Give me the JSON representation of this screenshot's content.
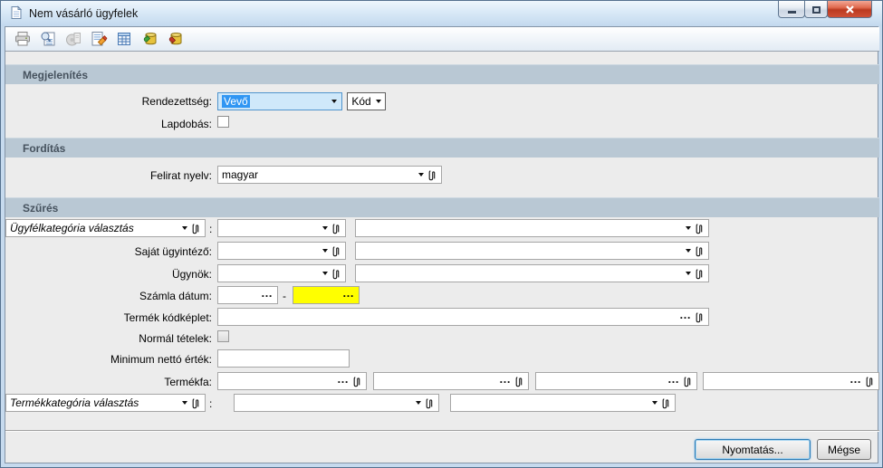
{
  "window": {
    "title": "Nem vásárló ügyfelek"
  },
  "toolbar": {
    "icons": [
      {
        "name": "print"
      },
      {
        "name": "print-preview"
      },
      {
        "name": "export-disabled"
      },
      {
        "name": "edit-report"
      },
      {
        "name": "table-settings"
      },
      {
        "name": "db-refresh"
      },
      {
        "name": "db-rollback"
      }
    ]
  },
  "megjelenites": {
    "title": "Megjelenítés",
    "rendezettseg_label": "Rendezettség:",
    "rendezettseg_value": "Vevő",
    "kod_label": "Kód",
    "lapdobas_label": "Lapdobás:"
  },
  "forditas": {
    "title": "Fordítás",
    "felirat_label": "Felirat nyelv:",
    "felirat_value": "magyar"
  },
  "szures": {
    "title": "Szűrés",
    "ugyfelkategoria_label": "Ügyfélkategória választás",
    "sajat_ugyintezo_label": "Saját ügyintéző:",
    "ugynok_label": "Ügynök:",
    "szamla_datum_label": "Számla dátum:",
    "termek_kodkeplet_label": "Termék kódképlet:",
    "normal_tetelek_label": "Normál tételek:",
    "minimum_netto_label": "Minimum nettó érték:",
    "termekfa_label": "Termékfa:",
    "termekkategoria_label": "Termékkategória választás",
    "colon": ":",
    "dash": "-"
  },
  "footer": {
    "print_label": "Nyomtatás...",
    "cancel_label": "Mégse"
  },
  "glyphs": {
    "ellipsis": "…"
  },
  "colors": {
    "section_header_bg": "#b9c8d4",
    "section_header_text": "#46525e",
    "content_bg": "#ececec",
    "focused_combo_bg": "#cfe8fa",
    "focused_combo_border": "#4f94cd",
    "selection_bg": "#3096f3",
    "highlight_yellow": "#ffff00",
    "titlebar_bg": "#d9e9f7",
    "close_button_red": "#bb3a20"
  }
}
